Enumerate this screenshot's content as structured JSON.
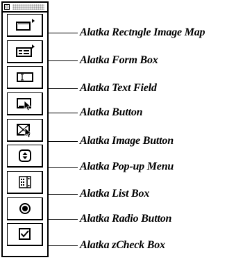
{
  "palette": {
    "tools": [
      {
        "icon": "rectangle-image-map-icon",
        "label": "Alatka Rectngle Image Map"
      },
      {
        "icon": "form-box-icon",
        "label": "Alatka Form Box"
      },
      {
        "icon": "text-field-icon",
        "label": "Alatka Text Field"
      },
      {
        "icon": "button-icon",
        "label": "Alatka Button"
      },
      {
        "icon": "image-button-icon",
        "label": "Alatka Image Button"
      },
      {
        "icon": "popup-menu-icon",
        "label": "Alatka Pop-up Menu"
      },
      {
        "icon": "list-box-icon",
        "label": "Alatka List Box"
      },
      {
        "icon": "radio-button-icon",
        "label": "Alatka Radio Button"
      },
      {
        "icon": "check-box-icon",
        "label": "Alatka zCheck Box"
      }
    ]
  }
}
